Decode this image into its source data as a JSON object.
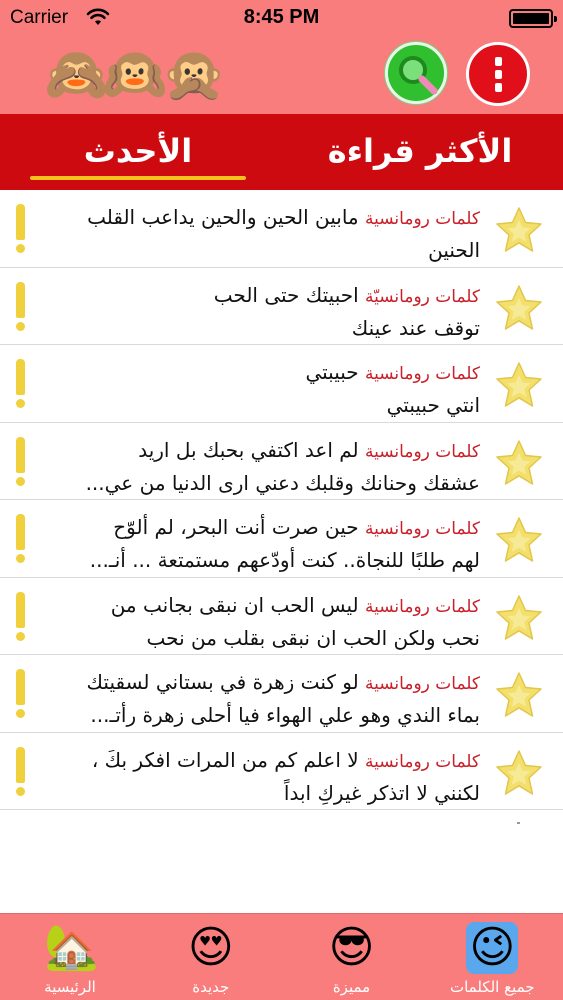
{
  "status": {
    "carrier": "Carrier",
    "time": "8:45 PM",
    "battery_level": 1.0
  },
  "header": {
    "logo_emoji": "🙈🙉🙊",
    "search_icon": "search-icon",
    "menu_icon": "kebab-menu-icon"
  },
  "tabs": {
    "latest": "الأحدث",
    "most_read": "الأكثر قراءة",
    "selected": "latest"
  },
  "posts": [
    {
      "category": "كلمات رومانسية",
      "line1": "مابين الحين والحين يداعب القلب",
      "line2": "الحنين"
    },
    {
      "category": "كلمات رومانسيّة",
      "line1": "احبيتك حتى الحب",
      "line2": "توقف عند عينك"
    },
    {
      "category": "كلمات رومانسية",
      "line1": "حبيبتي",
      "line2": "انتي حبيبتي"
    },
    {
      "category": "كلمات رومانسية",
      "line1": "لم اعد اكتفي بحبك بل اريد",
      "line2": "عشقك وحنانك وقلبك دعني ارى الدنيا من عي..."
    },
    {
      "category": "كلمات رومانسية",
      "line1": "حين صرت أنت البحر، لم ألوّح",
      "line2": "لهم طلبًا للنجاة.. كنت أودّعهم مستمتعة ... أنـ..."
    },
    {
      "category": "كلمات رومانسية",
      "line1": "ليس الحب ان نبقى بجانب من",
      "line2": "نحب ولكن الحب ان نبقى بقلب من نحب"
    },
    {
      "category": "كلمات رومانسية",
      "line1": "لو كنت زهرة في بستاني لسقيتك",
      "line2": "بماء الندي وهو علي الهواء فيا أحلى زهرة رأتـ..."
    },
    {
      "category": "كلمات رومانسية",
      "line1": "لا اعلم كم من المرات افكر بكَ ،",
      "line2": "لكنني لا اتذكر غيركِ ابداً"
    }
  ],
  "tabbar": [
    {
      "label": "الرئيسية",
      "icon": "🏡",
      "icon_name": "home-icon"
    },
    {
      "label": "جديدة",
      "icon": "😍",
      "icon_name": "heart-eyes-icon"
    },
    {
      "label": "مميزة",
      "icon": "😎",
      "icon_name": "sunglasses-icon"
    },
    {
      "label": "جميع الكلمات",
      "icon": "😉",
      "icon_name": "wink-icon",
      "active": true
    }
  ],
  "colors": {
    "header_bg": "#f97d7d",
    "tabs_bg": "#cc0a10",
    "indicator": "#f5c21b",
    "category_text": "#c9202a",
    "star_fill": "#f3e06c",
    "warn": "#f0d03c"
  }
}
